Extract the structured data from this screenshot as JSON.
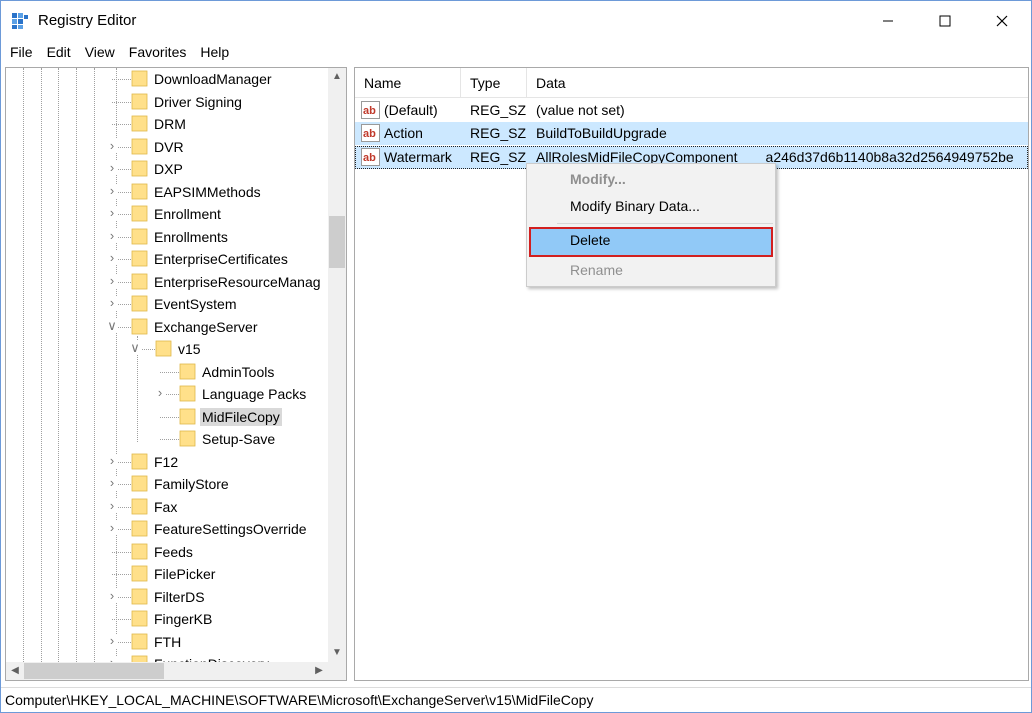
{
  "window": {
    "title": "Registry Editor"
  },
  "menu": [
    "File",
    "Edit",
    "View",
    "Favorites",
    "Help"
  ],
  "tree": {
    "items": [
      {
        "label": "DownloadManager",
        "expander": ""
      },
      {
        "label": "Driver Signing",
        "expander": ""
      },
      {
        "label": "DRM",
        "expander": ""
      },
      {
        "label": "DVR",
        "expander": ">"
      },
      {
        "label": "DXP",
        "expander": ">"
      },
      {
        "label": "EAPSIMMethods",
        "expander": ">"
      },
      {
        "label": "Enrollment",
        "expander": ">"
      },
      {
        "label": "Enrollments",
        "expander": ">"
      },
      {
        "label": "EnterpriseCertificates",
        "expander": ">"
      },
      {
        "label": "EnterpriseResourceManag",
        "expander": ">"
      },
      {
        "label": "EventSystem",
        "expander": ">"
      },
      {
        "label": "ExchangeServer",
        "expander": "v"
      },
      {
        "label": "v15",
        "expander": "v"
      },
      {
        "label": "AdminTools",
        "expander": ""
      },
      {
        "label": "Language Packs",
        "expander": ">"
      },
      {
        "label": "MidFileCopy",
        "expander": ""
      },
      {
        "label": "Setup-Save",
        "expander": ""
      },
      {
        "label": "F12",
        "expander": ">"
      },
      {
        "label": "FamilyStore",
        "expander": ">"
      },
      {
        "label": "Fax",
        "expander": ">"
      },
      {
        "label": "FeatureSettingsOverride",
        "expander": ">"
      },
      {
        "label": "Feeds",
        "expander": ""
      },
      {
        "label": "FilePicker",
        "expander": ""
      },
      {
        "label": "FilterDS",
        "expander": ">"
      },
      {
        "label": "FingerKB",
        "expander": ""
      },
      {
        "label": "FTH",
        "expander": ">"
      },
      {
        "label": "FunctionDiscovery",
        "expander": ">"
      }
    ],
    "selected": "MidFileCopy"
  },
  "list": {
    "columns": [
      "Name",
      "Type",
      "Data"
    ],
    "rows": [
      {
        "name": "(Default)",
        "type": "REG_SZ",
        "data": "(value not set)"
      },
      {
        "name": "Action",
        "type": "REG_SZ",
        "data": "BuildToBuildUpgrade"
      },
      {
        "name": "Watermark",
        "type": "REG_SZ",
        "data": "AllRolesMidFileCopyComponent  a246d37d6b1140b8a32d2564949752be"
      }
    ]
  },
  "context_menu": {
    "items": [
      "Modify...",
      "Modify Binary Data...",
      "Delete",
      "Rename"
    ],
    "highlighted": "Delete"
  },
  "status": {
    "path": "Computer\\HKEY_LOCAL_MACHINE\\SOFTWARE\\Microsoft\\ExchangeServer\\v15\\MidFileCopy"
  },
  "icons": {
    "app": "registry-icon",
    "folder": "folder-icon",
    "value": "string-value-icon"
  },
  "colors": {
    "selection": "#cce8ff",
    "menu_highlight": "#91c9f7",
    "callout_border": "#d21f1f",
    "folder": "#ffe08a"
  }
}
